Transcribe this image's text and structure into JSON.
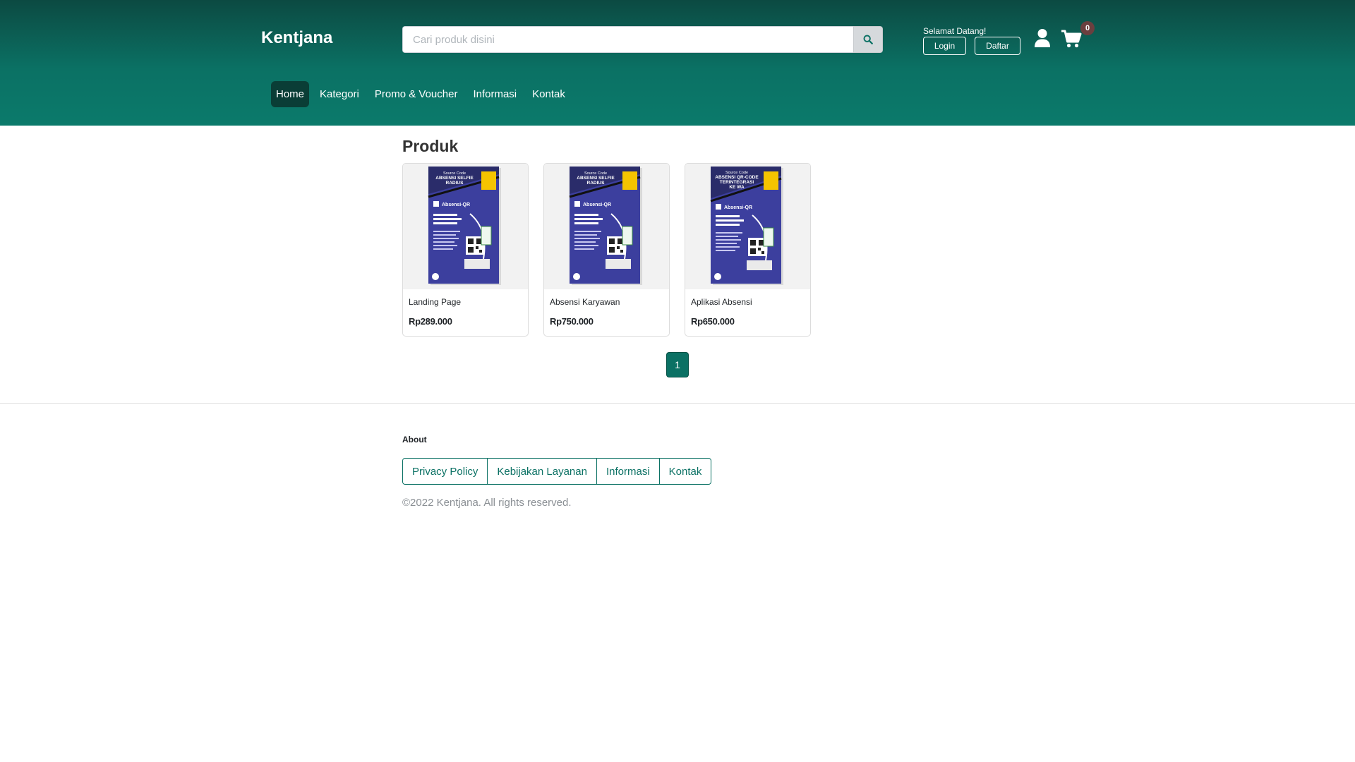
{
  "header": {
    "brand": "Kentjana",
    "search": {
      "placeholder": "Cari produk disini",
      "button_icon": "search-icon"
    },
    "welcome": "Selamat Datang!",
    "login_label": "Login",
    "register_label": "Daftar",
    "cart_count": "0",
    "icons": [
      "user-icon",
      "cart-icon"
    ],
    "colors": {
      "header_top": "#0c4a42",
      "header_bottom": "#0b7a6b",
      "active_nav": "#0a3d36"
    }
  },
  "nav": {
    "items": [
      {
        "label": "Home",
        "active": true
      },
      {
        "label": "Kategori"
      },
      {
        "label": "Promo & Voucher"
      },
      {
        "label": "Informasi"
      },
      {
        "label": "Kontak"
      }
    ]
  },
  "main": {
    "title": "Produk",
    "products": [
      {
        "name": "Landing Page",
        "price": "Rp289.000",
        "cover": {
          "source": "Source Code",
          "title_lines": [
            "ABSENSI SELFIE",
            "RADIUS"
          ],
          "brand": "Absensi-QR"
        }
      },
      {
        "name": "Absensi Karyawan",
        "price": "Rp750.000",
        "cover": {
          "source": "Source Code",
          "title_lines": [
            "ABSENSI SELFIE",
            "RADIUS"
          ],
          "brand": "Absensi-QR"
        }
      },
      {
        "name": "Aplikasi Absensi",
        "price": "Rp650.000",
        "cover": {
          "source": "Source Code",
          "title_lines": [
            "ABSENSI QR-CODE",
            "TERINTEGRASI",
            "KE WA"
          ],
          "brand": "Absensi-QR"
        }
      }
    ],
    "pagination": {
      "current": "1"
    }
  },
  "footer": {
    "about_heading": "About",
    "links": [
      "Privacy Policy",
      "Kebijakan Layanan",
      "Informasi",
      "Kontak"
    ],
    "copyright": "©2022 Kentjana. All rights reserved.",
    "accent_color": "#0b7164"
  }
}
